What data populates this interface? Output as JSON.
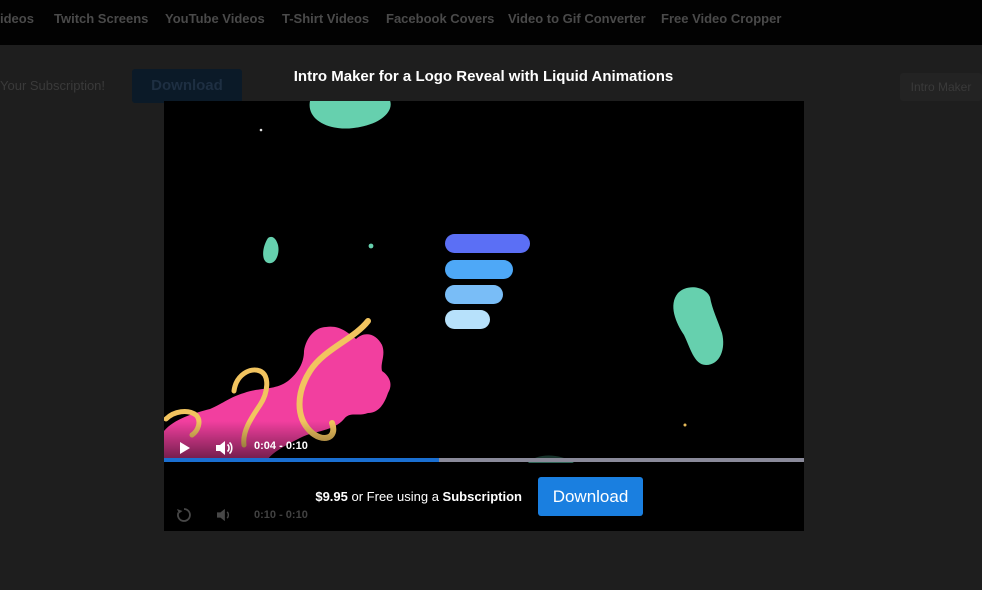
{
  "nav": {
    "items": [
      "ideos",
      "Twitch Screens",
      "YouTube Videos",
      "T-Shirt Videos",
      "Facebook Covers",
      "Video to Gif Converter",
      "Free Video Cropper"
    ]
  },
  "background": {
    "subscription_text": "Your Subscription!",
    "download_label": "Download",
    "intro_maker_label": "Intro Maker"
  },
  "modal": {
    "title": "Intro Maker for a Logo Reveal with Liquid Animations",
    "player": {
      "current_time": "0:04",
      "duration": "0:10",
      "time_separator": " - ",
      "progress_fraction": 0.43,
      "ghost_time": "0:10 - 0:10"
    },
    "price": "$9.95",
    "price_mid": " or Free using a ",
    "subscription_word": "Subscription",
    "download_label": "Download"
  },
  "colors": {
    "accent_blue": "#1a7fe0",
    "teal_blob": "#66d0ae",
    "pink_blob": "#f23f9f",
    "gold_ribbon": "#f2c45f",
    "bar_1": "#5b6ff5",
    "bar_2": "#4ea8f7",
    "bar_3": "#79bdf7",
    "bar_4": "#b7e1fb"
  }
}
